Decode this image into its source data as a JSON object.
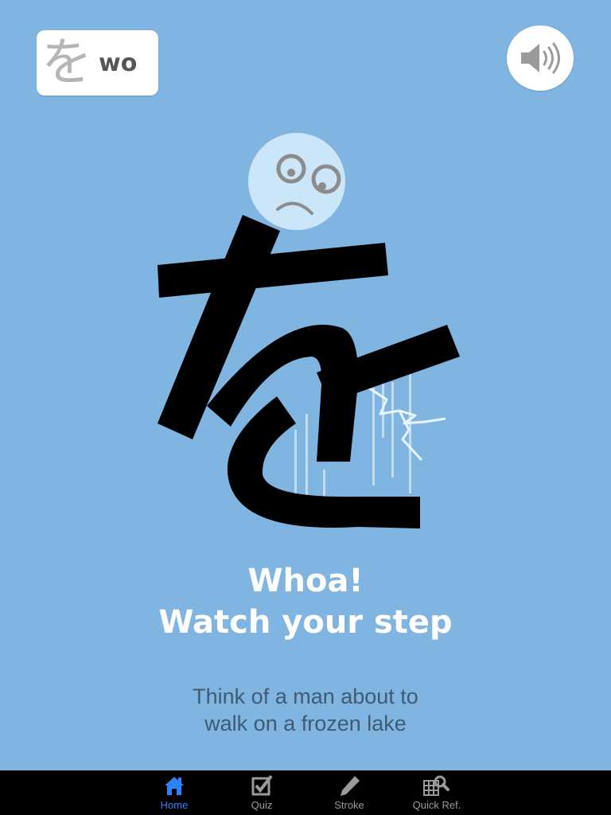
{
  "kana": {
    "character": "を",
    "romaji": "wo"
  },
  "sound_button": {
    "icon": "speaker-icon"
  },
  "mnemonic": {
    "headline_line1": "Whoa!",
    "headline_line2": "Watch your step",
    "hint_line1": "Think of a man about to",
    "hint_line2": "walk on a frozen lake"
  },
  "tabs": [
    {
      "label": "Home",
      "icon": "home-icon",
      "active": true
    },
    {
      "label": "Quiz",
      "icon": "checkbox-icon",
      "active": false
    },
    {
      "label": "Stroke",
      "icon": "pencil-icon",
      "active": false
    },
    {
      "label": "Quick Ref.",
      "icon": "grid-search-icon",
      "active": false
    }
  ],
  "colors": {
    "background": "#80b5e2",
    "tab_active": "#2f82ff",
    "tab_inactive": "#9a9a9a",
    "headline": "#ffffff",
    "hint": "#3f5a73"
  }
}
